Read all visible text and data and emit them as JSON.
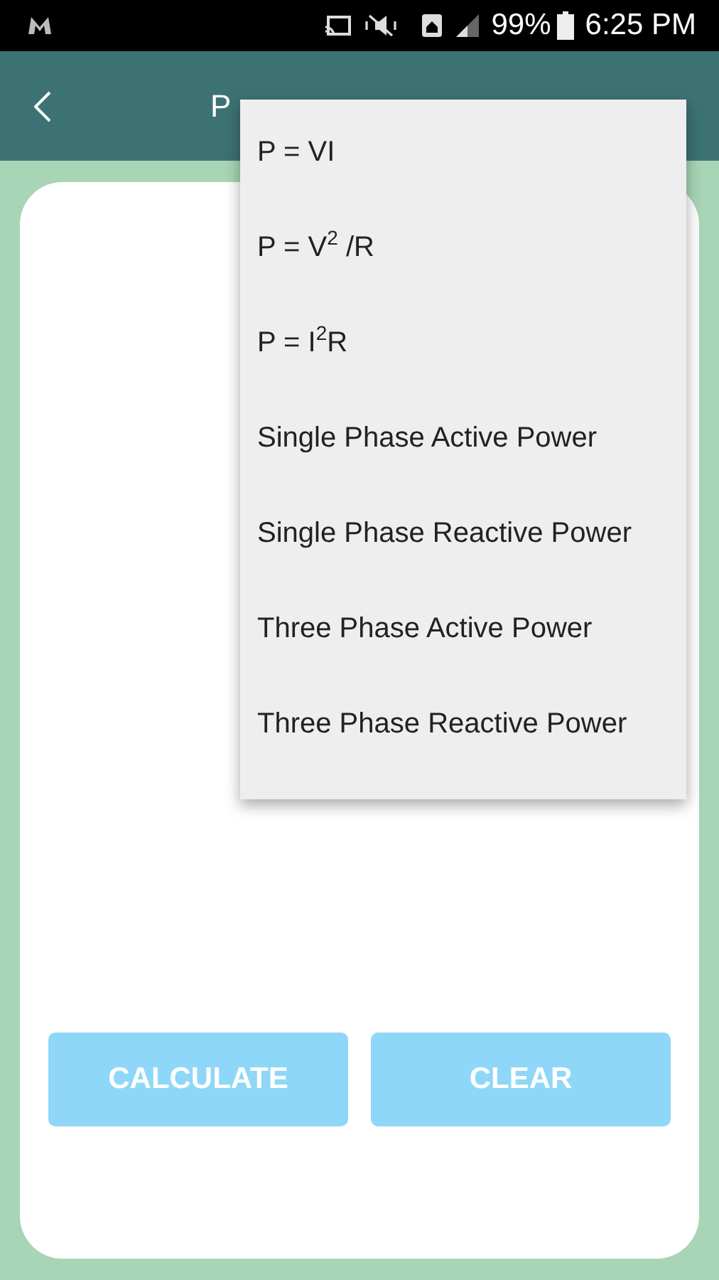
{
  "status_bar": {
    "battery_text": "99%",
    "time": "6:25 PM"
  },
  "app_bar": {
    "title": "P"
  },
  "buttons": [
    {
      "label": "CALCULATE",
      "disabled": true
    },
    {
      "label": "CLEAR",
      "disabled": true
    }
  ],
  "menu": {
    "items": [
      {
        "label": "P = VI"
      },
      {
        "label": "P = V$^{2}$ /R"
      },
      {
        "label": "P = I$^{2}$R"
      },
      {
        "label": "Single Phase Active Power"
      },
      {
        "label": "Single Phase Reactive Power"
      },
      {
        "label": "Three Phase Active Power"
      },
      {
        "label": "Three Phase Reactive Power"
      }
    ]
  }
}
